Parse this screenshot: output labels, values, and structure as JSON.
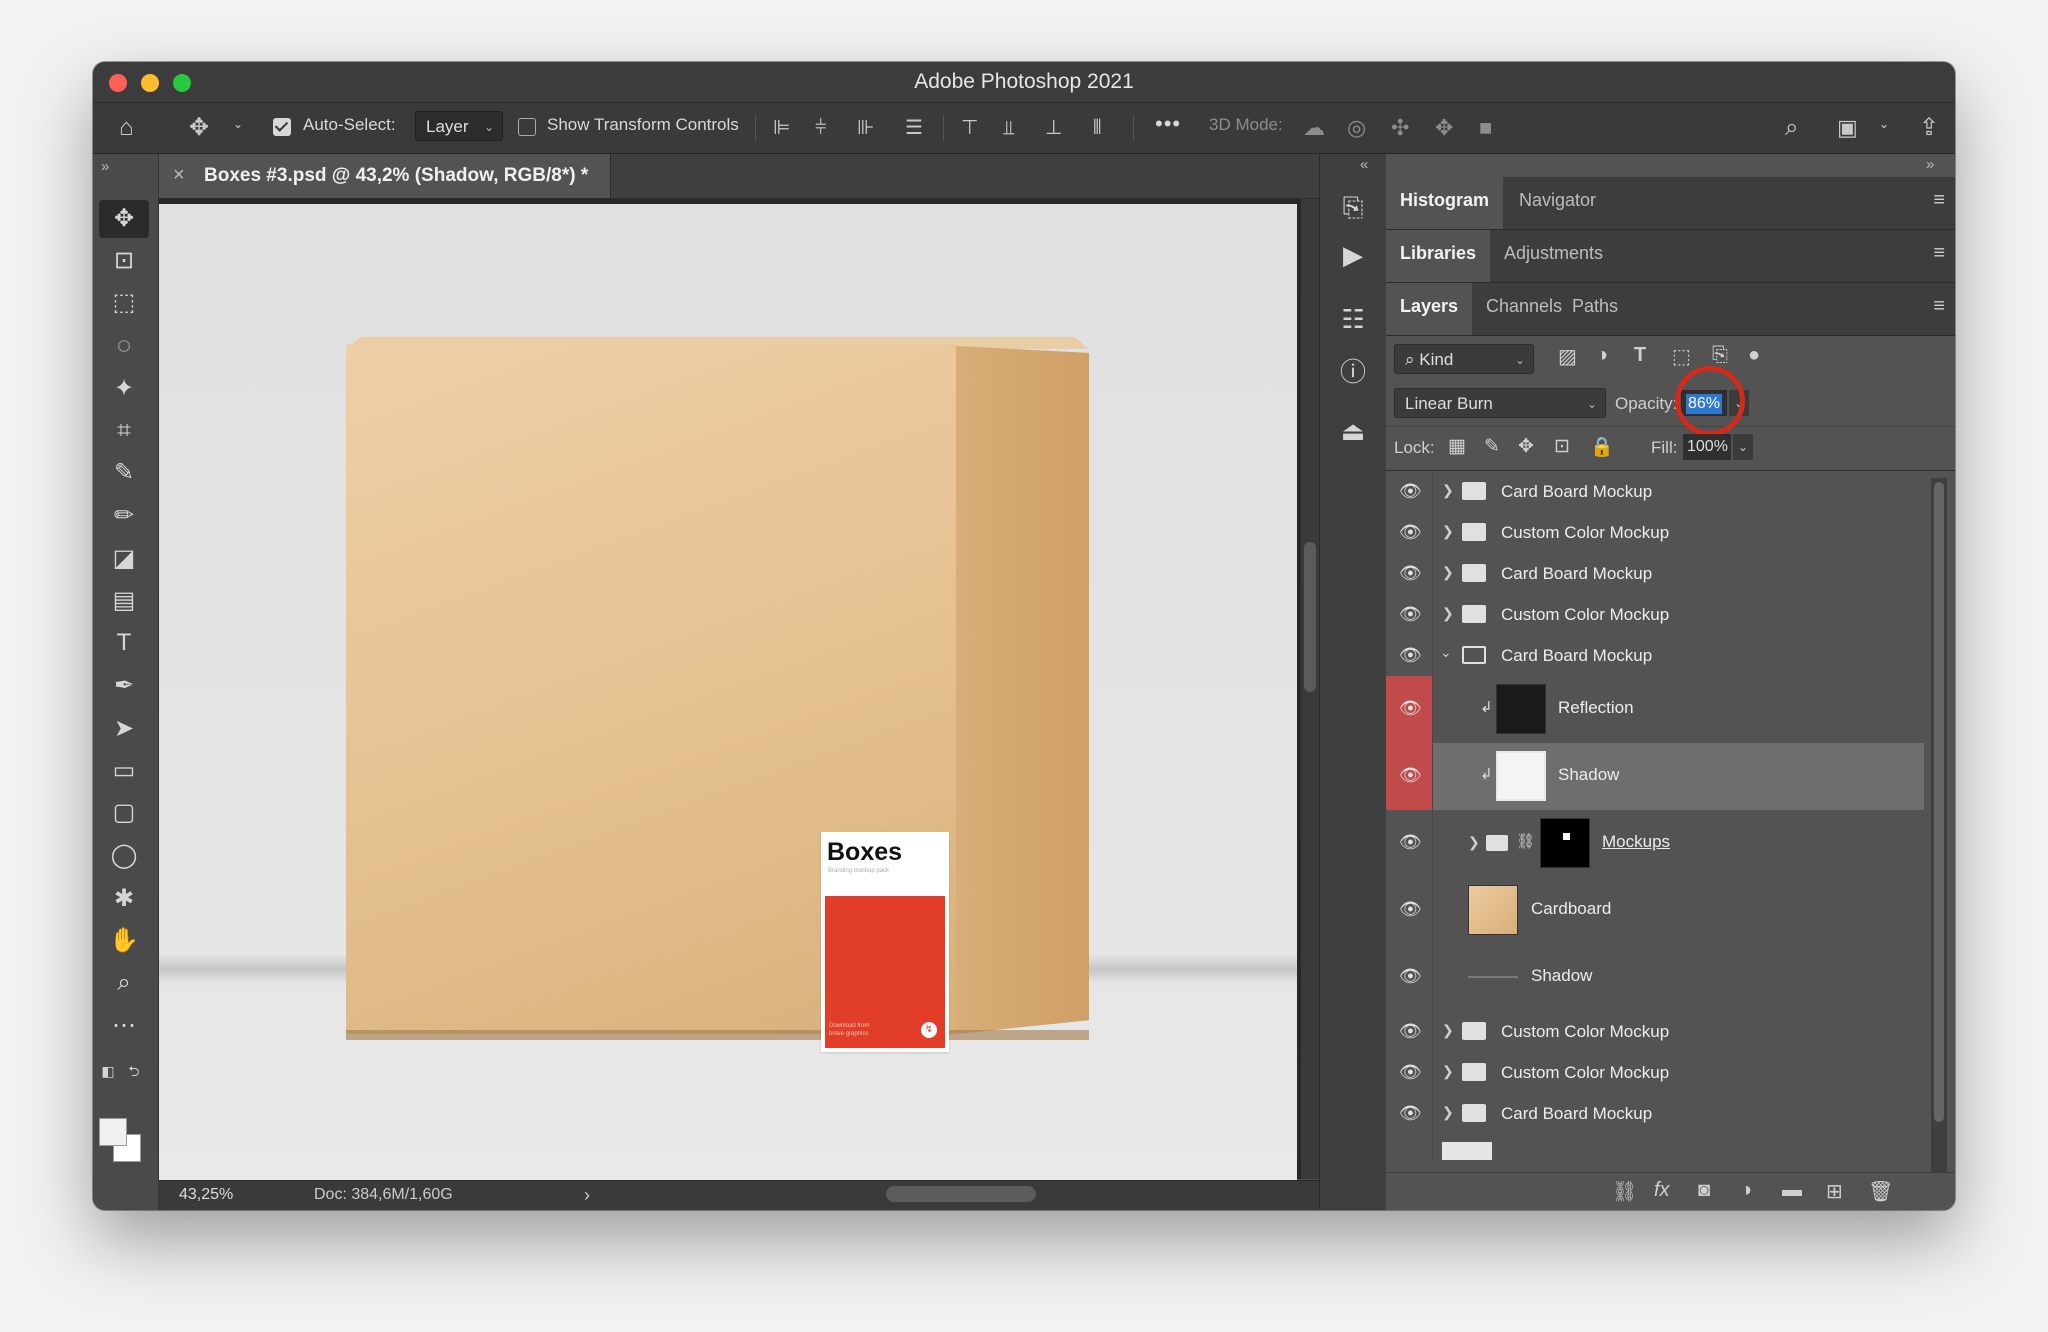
{
  "window": {
    "title": "Adobe Photoshop 2021"
  },
  "optionsbar": {
    "auto_select_label": "Auto-Select:",
    "auto_select_value": "Layer",
    "show_transform_label": "Show Transform Controls",
    "mode_3d_label": "3D Mode:",
    "more_label": "•••"
  },
  "document": {
    "tab_title": "Boxes #3.psd @ 43,2% (Shadow, RGB/8*) *",
    "zoom": "43,25%",
    "doc_info": "Doc: 384,6M/1,60G",
    "label_title": "Boxes",
    "label_subtitle": "Branding mockup pack",
    "label_footer": "Download from\nbrave graphics"
  },
  "panels": {
    "group1": {
      "tabs": [
        "Histogram",
        "Navigator"
      ]
    },
    "group2": {
      "tabs": [
        "Libraries",
        "Adjustments"
      ]
    },
    "group3": {
      "tabs": [
        "Layers",
        "Channels",
        "Paths"
      ]
    }
  },
  "layers_panel": {
    "filter_kind": "Kind",
    "blend_mode": "Linear Burn",
    "opacity_label": "Opacity:",
    "opacity_value": "86%",
    "lock_label": "Lock:",
    "fill_label": "Fill:",
    "fill_value": "100%",
    "layers": [
      {
        "name": "Card Board Mockup",
        "type": "group"
      },
      {
        "name": "Custom Color Mockup",
        "type": "group"
      },
      {
        "name": "Card Board Mockup",
        "type": "group"
      },
      {
        "name": "Custom Color Mockup",
        "type": "group"
      },
      {
        "name": "Card Board Mockup",
        "type": "group-open"
      },
      {
        "name": "Reflection",
        "type": "clipped"
      },
      {
        "name": "Shadow",
        "type": "clipped",
        "selected": true
      },
      {
        "name": "Mockups",
        "type": "smart-group"
      },
      {
        "name": "Cardboard",
        "type": "image"
      },
      {
        "name": "Shadow",
        "type": "line"
      },
      {
        "name": "Custom Color Mockup",
        "type": "group"
      },
      {
        "name": "Custom Color Mockup",
        "type": "group"
      },
      {
        "name": "Card Board Mockup",
        "type": "group"
      }
    ]
  },
  "colors": {
    "accent_blue": "#2e78d2",
    "highlight_red": "#d32a1c",
    "eye_highlight": "#c14b4b",
    "label_red": "#e13d29"
  }
}
